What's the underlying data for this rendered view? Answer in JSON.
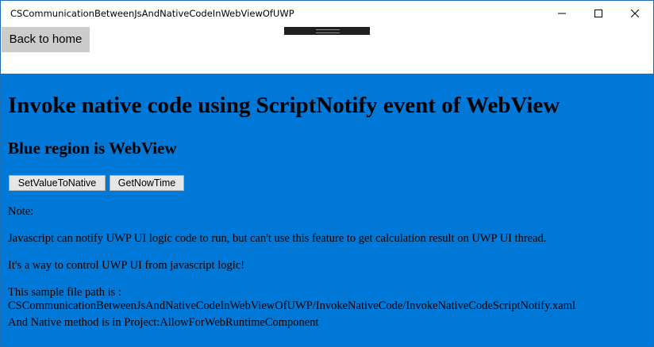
{
  "window": {
    "title": "CSCommunicationBetweenJsAndNativeCodeInWebViewOfUWP"
  },
  "app_bar": {
    "back_label": "Back to home"
  },
  "webview": {
    "heading": "Invoke native code using ScriptNotify event of WebView",
    "subheading": "Blue region is WebView",
    "buttons": {
      "set_value": "SetValueToNative",
      "get_now_time": "GetNowTime"
    },
    "note_label": "Note:",
    "paragraph_1": "Javascript can notify UWP UI logic code to run, but can't use this feature to get calculation result on UWP UI thread.",
    "paragraph_2": "It's a way to control UWP UI from javascript logic!",
    "path_label": "This sample file path is :",
    "path_value": "CSCommunicationBetweenJsAndNativeCodeInWebViewOfUWP/InvokeNativeCode/InvokeNativeCodeScriptNotify.xaml",
    "native_method": "And Native method is in Project:AllowForWebRuntimeComponent"
  },
  "colors": {
    "webview_background": "#0078d7",
    "back_button_background": "#cccccc",
    "window_border": "#1b6fb5"
  },
  "icons": {
    "minimize": "minimize-icon",
    "maximize": "maximize-icon",
    "close": "close-icon"
  }
}
